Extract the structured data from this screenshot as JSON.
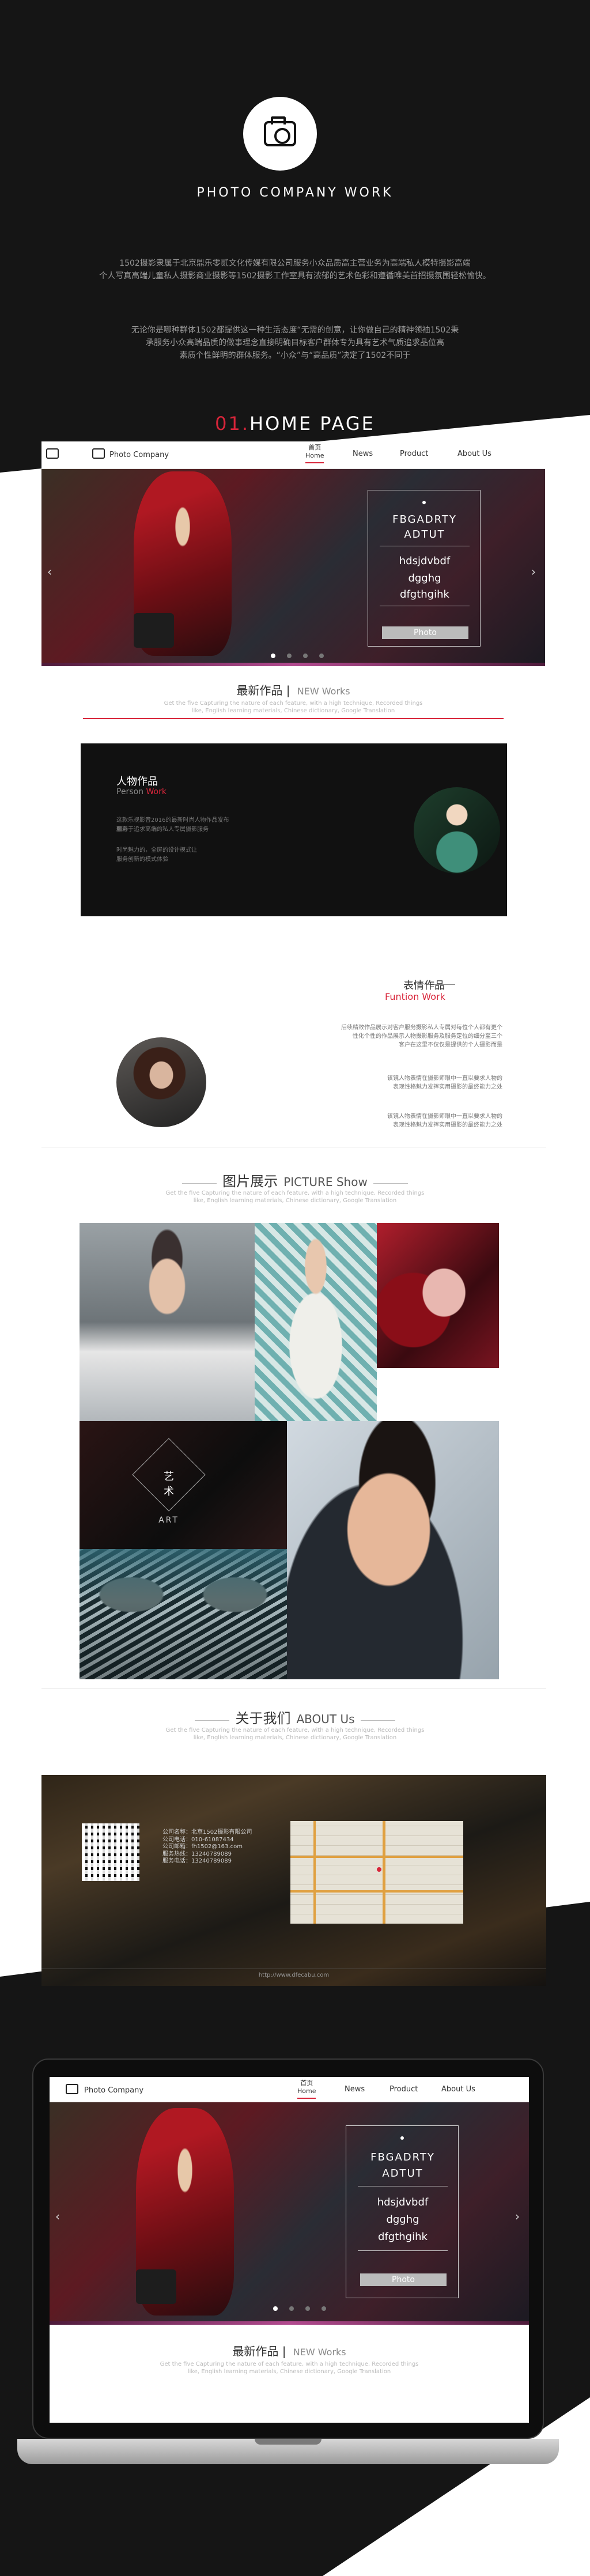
{
  "intro": {
    "site_title": "PHOTO COMPANY WORK",
    "para1_line1": "1502摄影隶属于北京鼎乐零贰文化传媒有限公司服务小众品质高主营业务为高端私人模特摄影高端",
    "para1_line2": "个人写真高端儿童私人摄影商业摄影等1502摄影工作室具有浓郁的艺术色彩和遵循唯美首招摄氛围轻松愉快。",
    "para2_line1": "无论你是哪种群体1502都提供这一种生活态度“无需的创意，让你做自己的精神领袖1502秉",
    "para2_line2": "承服务小众高端品质的做事理念直接明确目标客户群体专为具有艺术气质追求品位高",
    "para2_line3": "素质个性鲜明的群体服务。“小众”与“高品质”决定了1502不同于",
    "section_num": "01.",
    "section_title": "HOME PAGE"
  },
  "nav": {
    "brand": "Photo Company",
    "items": [
      {
        "label": "首页",
        "sub": "Home"
      },
      {
        "label": "News"
      },
      {
        "label": "Product"
      },
      {
        "label": "About Us"
      }
    ]
  },
  "hero": {
    "line1": "FBGADRTY",
    "line2": "ADTUT",
    "line3": "hdsjdvbdf",
    "line4": "dgghg",
    "line5": "dfgthgihk",
    "button": "Photo",
    "arrow_left": "‹",
    "arrow_right": "›"
  },
  "new_works": {
    "cn": "最新作品",
    "en": "NEW  Works",
    "sub1": "Get the five Capturing the nature of each feature, with a high technique, Recorded things",
    "sub2": "like, English learning materials, Chinese dictionary, Google Translation"
  },
  "persons": {
    "title": "人物作品",
    "sub_a": "Person ",
    "sub_b": "Work",
    "p1": "这款乐视影音2016的最新时尚人物作品发布精彩",
    "p2": "服务于追求高端的私人专属摄影服务",
    "p3": "时尚魅力的，全屏的设计模式让",
    "p4": "服务创新的模式体验"
  },
  "express": {
    "title": "表情作品",
    "sub": "Funtion Work",
    "p1a": "后续精致作品展示对客户服务摄影私人专属对每位个人都有更个",
    "p1b": "性化个性的作品展示人物摄影服务及服务定位的细分至三个",
    "p1c": "客户在这里不仅仅是提供的个人摄影而是",
    "p2a": "该镜人物表情在摄影师眼中一直以要求人物的",
    "p2b": "表现性格魅力发挥实用摄影的最终能力之处",
    "p3a": "该镜人物表情在摄影师眼中一直以要求人物的",
    "p3b": "表现性格魅力发挥实用摄影的最终能力之处"
  },
  "gallery": {
    "cn": "图片展示",
    "en": "PICTURE Show",
    "sub1": "Get the five Capturing the nature of each feature, with a high technique, Recorded things",
    "sub2": "like, English learning materials, Chinese dictionary, Google Translation",
    "art_cn": "艺术",
    "art_en": "ART"
  },
  "about": {
    "cn": "关于我们",
    "en": "ABOUT Us",
    "sub1": "Get the five Capturing the nature of each feature, with a high technique, Recorded things",
    "sub2": "like, English learning materials, Chinese dictionary, Google Translation",
    "info": [
      "公司名称：北京1502摄影有限公司",
      "公司电话：010-61087434",
      "公司邮箱：fh1502@163.com",
      "服务热线：13240789089",
      "服务电话：13240789089"
    ],
    "url": "http://www.dfecabu.com"
  },
  "colors": {
    "accent": "#d8253a",
    "dark": "#151515"
  }
}
